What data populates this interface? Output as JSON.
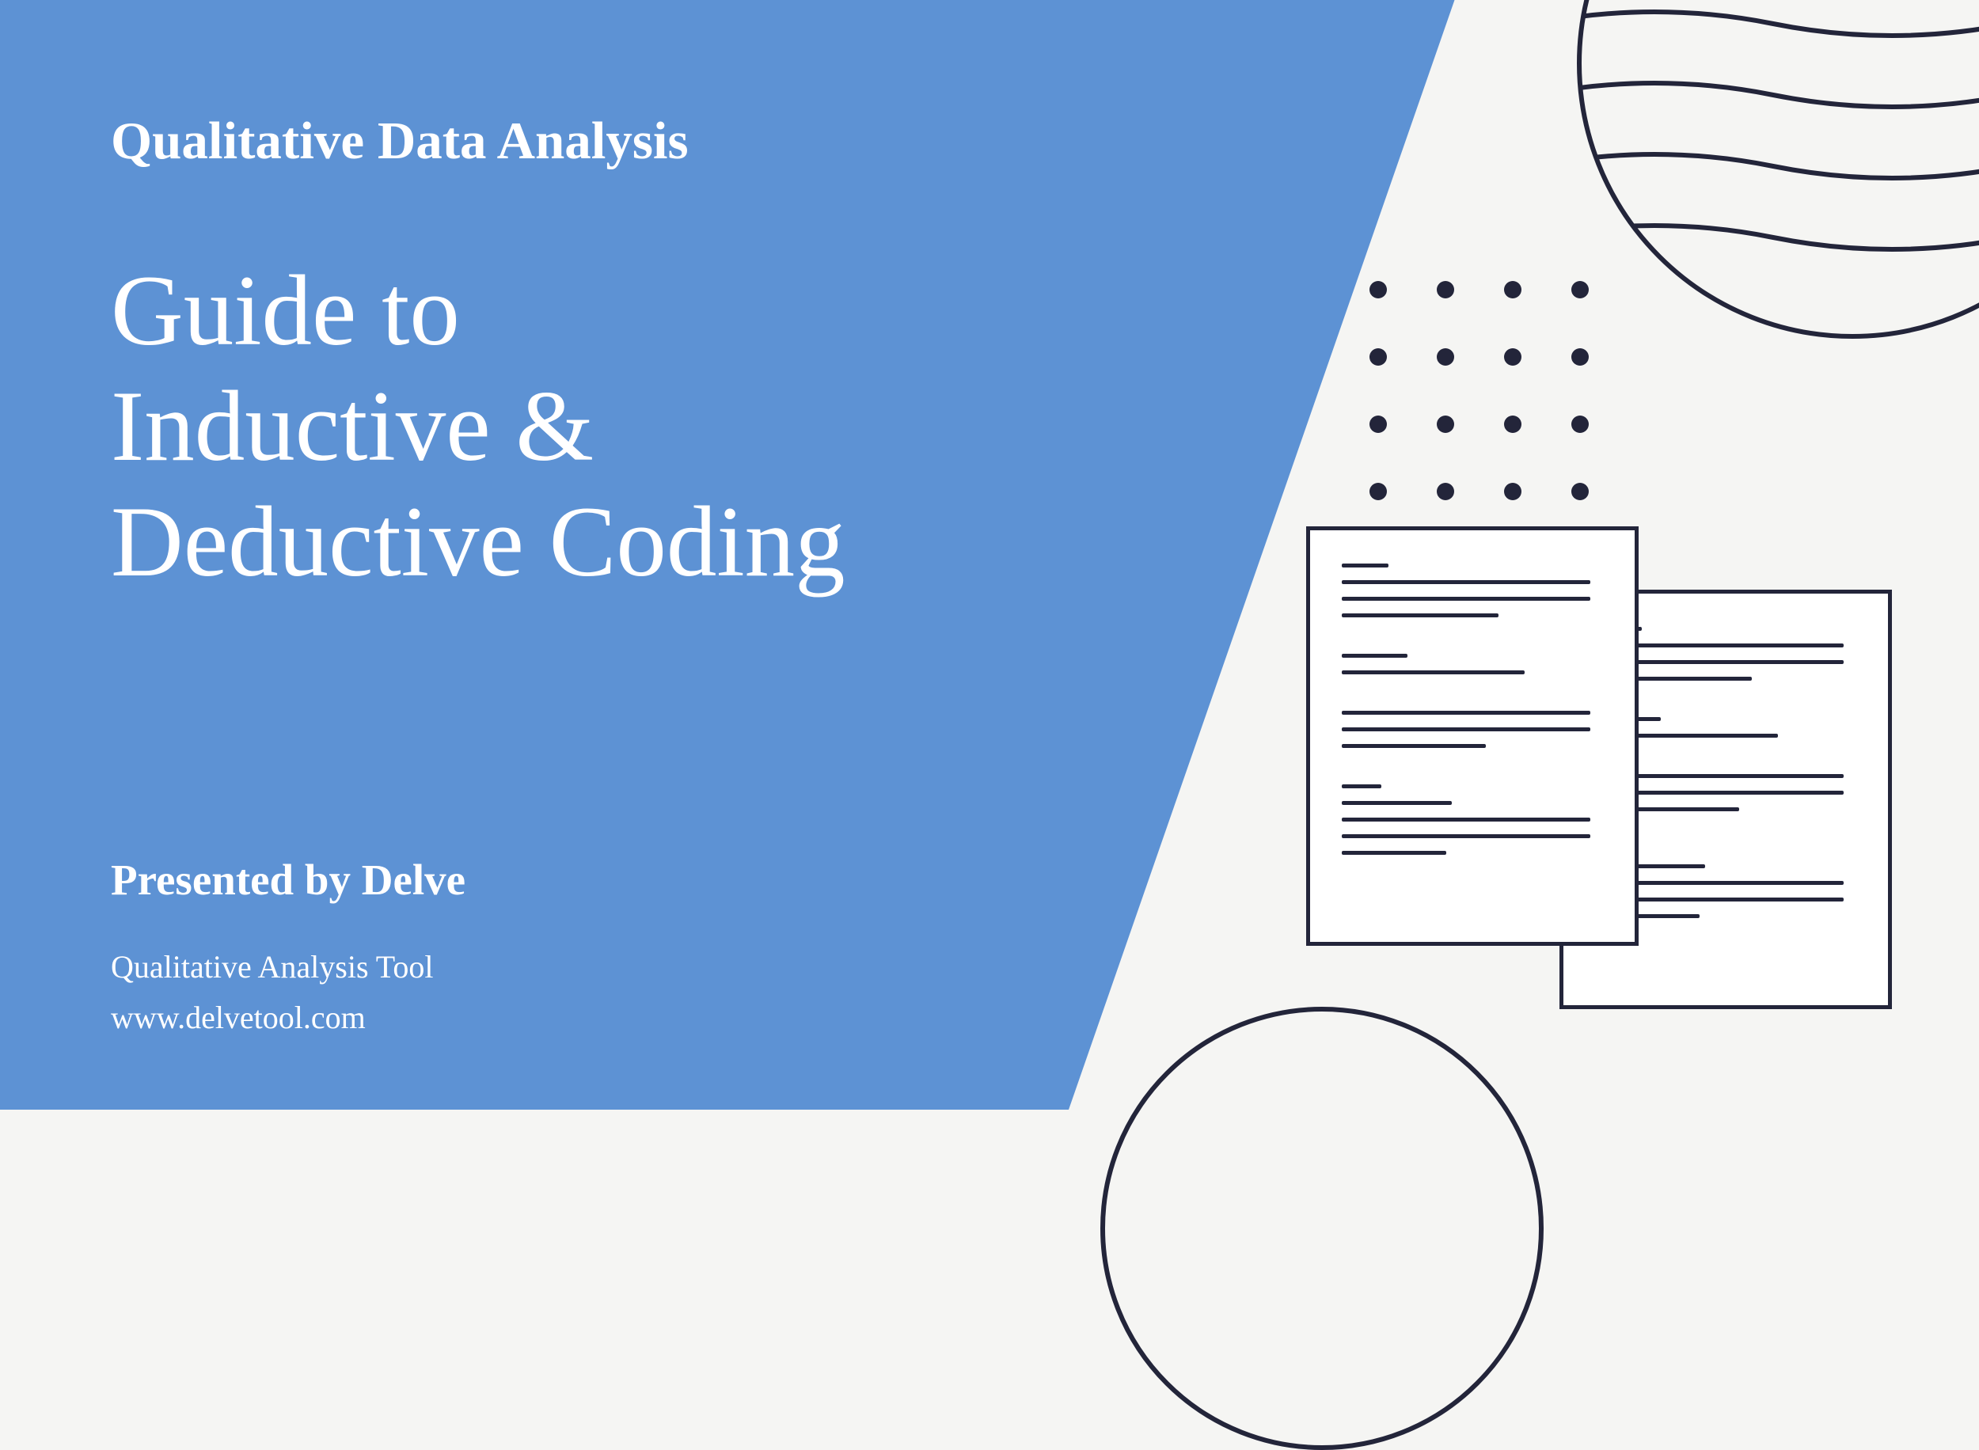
{
  "eyebrow": "Qualitative Data Analysis",
  "title_line1": "Guide to",
  "title_line2": "Inductive &",
  "title_line3": "Deductive Coding",
  "presented": "Presented by Delve",
  "footer_line1": "Qualitative Analysis Tool",
  "footer_line2": "www.delvetool.com"
}
